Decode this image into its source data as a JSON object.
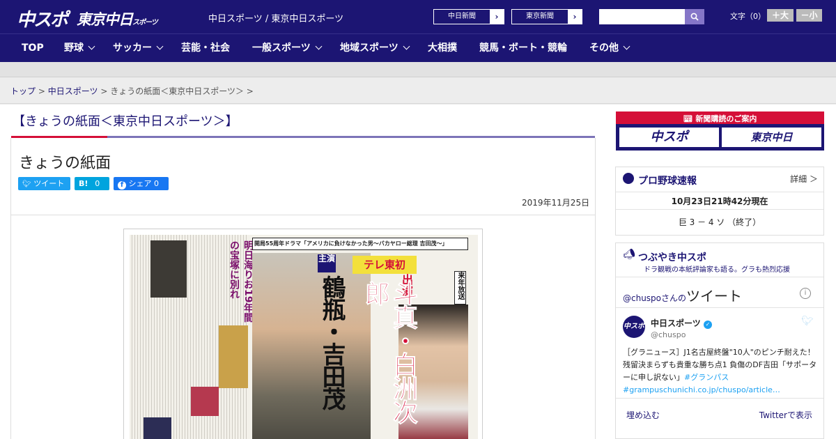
{
  "header": {
    "logo_main": "中スポ",
    "logo_tokyo": "東京中日",
    "logo_tokyo_sub": "スポーツ",
    "site_links": "中日スポーツ / 東京中日スポーツ",
    "paper_buttons": [
      "中日新聞",
      "東京新聞"
    ],
    "search_placeholder": "",
    "font_size_label": "文字（0）",
    "font_larger": "＋大",
    "font_smaller": "－小"
  },
  "nav": [
    "TOP",
    "野球",
    "サッカー",
    "芸能・社会",
    "一般スポーツ",
    "地域スポーツ",
    "大相撲",
    "競馬・ボート・競輪",
    "その他"
  ],
  "breadcrumb": {
    "items": [
      "トップ",
      "中日スポーツ"
    ],
    "current": "きょうの紙面＜東京中日スポーツ＞"
  },
  "main": {
    "heading": "【きょうの紙面＜東京中日スポーツ＞】",
    "title": "きょうの紙面",
    "share": {
      "tweet": "ツイート",
      "hatena": "B!",
      "hatena_count": "0",
      "facebook": "シェア",
      "facebook_count": "0"
    },
    "date": "2019年11月25日",
    "newspaper": {
      "banner": "開局55周年ドラマ「アメリカに負けなかった男～バカヤロー総理 吉田茂～」",
      "lead": "主演",
      "network": "テレ東初",
      "actor1": "鶴瓶・吉田茂",
      "appear": "出演",
      "actor2": "斗真・白洲次郎",
      "tag": "来年放送",
      "side_headline": "明日海りお19年間の宝塚に別れ"
    }
  },
  "sidebar": {
    "promo_title": "新聞購読のご案内",
    "promo_buttons": [
      "中スポ",
      "東京中日"
    ],
    "baseball": {
      "title": "プロ野球速報",
      "detail": "詳細 ＞",
      "timestamp": "10月23日21時42分現在",
      "score": "巨 3 － 4 ソ （終了）"
    },
    "tweets": {
      "title": "つぶやき中スポ",
      "subtitle": "ドラ観戦の本紙評論家も語る。グラも熱烈応援",
      "handle_line": "@chuspoさんの",
      "handle_suffix": "ツイート",
      "author": "中日スポーツ",
      "author_handle": "@chuspo",
      "text": "［グラニュース］J1名古屋終盤\"10人\"のピンチ耐えた！残留決まらずも貴重な勝ち点1 負傷のDF吉田「サポーターに申し訳ない」",
      "hashtag": "#グランパス",
      "link": "#grampuschunichi.co.jp/chuspo/article…",
      "embed": "埋め込む",
      "view_on_twitter": "Twitterで表示"
    }
  },
  "colors": {
    "brand_navy": "#1c1573",
    "accent_red": "#d50f38",
    "twitter_blue": "#1da1f2",
    "facebook_blue": "#1877f2"
  }
}
